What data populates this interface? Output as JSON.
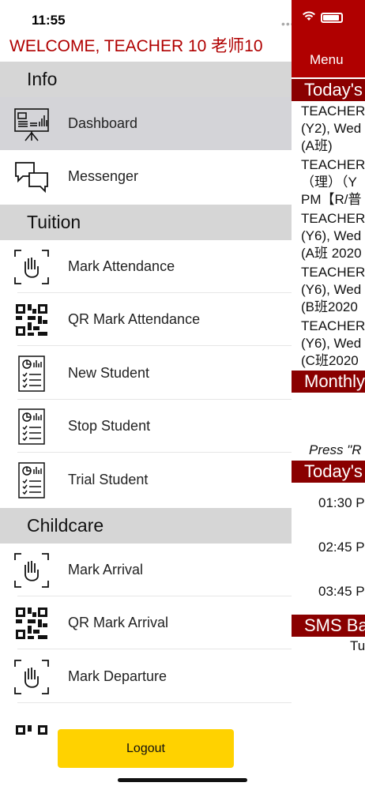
{
  "status_bar": {
    "time": "11:55"
  },
  "background": {
    "menu_label": "Menu",
    "sections": [
      "Today's",
      "Monthly",
      "Today's",
      "SMS Ba"
    ],
    "lines": [
      "TEACHER",
      "(Y2), Wed",
      "(A班)",
      "TEACHER",
      "（理）（Y",
      "PM【R/普",
      "TEACHER",
      "(Y6), Wed",
      "(A班 2020",
      "TEACHER",
      "(Y6), Wed",
      "(B班2020",
      "TEACHER",
      "(Y6), Wed",
      "(C班2020"
    ],
    "press_text": "Press \"R",
    "times": [
      "01:30 P",
      "02:45 P",
      "03:45 P"
    ],
    "sms_line": "Tu"
  },
  "drawer": {
    "welcome": "WELCOME, TEACHER 10 老师10",
    "sections": {
      "info": "Info",
      "tuition": "Tuition",
      "childcare": "Childcare"
    },
    "items": {
      "dashboard": "Dashboard",
      "messenger": "Messenger",
      "mark_attendance": "Mark Attendance",
      "qr_mark_attendance": "QR Mark Attendance",
      "new_student": "New Student",
      "stop_student": "Stop Student",
      "trial_student": "Trial Student",
      "mark_arrival": "Mark Arrival",
      "qr_mark_arrival": "QR Mark Arrival",
      "mark_departure": "Mark Departure"
    },
    "logout": "Logout"
  },
  "colors": {
    "brand": "#b00000",
    "logout": "#ffd200",
    "section_bg": "#d6d6d6"
  }
}
